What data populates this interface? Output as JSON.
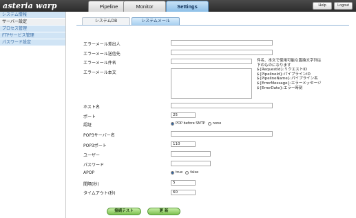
{
  "app": {
    "logo": "asteria warp"
  },
  "tabs": [
    {
      "label": "Pipeline"
    },
    {
      "label": "Monitor"
    },
    {
      "label": "Settings"
    }
  ],
  "header_buttons": {
    "help": "Help",
    "logout": "Logout"
  },
  "sidebar": {
    "items": [
      {
        "label": "システム情報"
      },
      {
        "label": "サーバー設定"
      },
      {
        "label": "プロセス管理"
      },
      {
        "label": "FTPサービス管理"
      },
      {
        "label": "パスワード設定"
      }
    ]
  },
  "subtabs": [
    {
      "label": "システムDB"
    },
    {
      "label": "システムメール"
    }
  ],
  "form": {
    "error_from_label": "エラーメール差出人",
    "error_from_value": "",
    "error_to_label": "エラーメール送信先",
    "error_to_value": "",
    "error_subject_label": "エラーメール件名",
    "error_subject_value": "",
    "error_body_label": "エラーメール本文",
    "error_body_value": "",
    "note_lines": [
      "件名、本文で使用可能な置換文字列は",
      "下のものになります",
      "${RequestId}:リクエストID",
      "${PipelineId}:パイプラインID",
      "${PipelineName}:パイプライン名",
      "${ErrorMessage}:エラーメッセージ",
      "${ErrorDate}:エラー時刻"
    ],
    "host_label": "ホスト名",
    "host_value": "",
    "port_label": "ポート",
    "port_value": "25",
    "auth_label": "認証",
    "auth_option_1": "POP before SMTP",
    "auth_option_2": "none",
    "pop3_server_label": "POP3サーバー名",
    "pop3_server_value": "",
    "pop3_port_label": "POP3ポート",
    "pop3_port_value": "110",
    "user_label": "ユーザー",
    "user_value": "",
    "password_label": "パスワード",
    "password_value": "",
    "apop_label": "APOP",
    "apop_option_1": "true",
    "apop_option_2": "false",
    "interval_label": "間隔(秒)",
    "interval_value": "5",
    "timeout_label": "タイムアウト(秒)",
    "timeout_value": "60"
  },
  "buttons": {
    "test": "接続テスト",
    "update": "更 新"
  }
}
